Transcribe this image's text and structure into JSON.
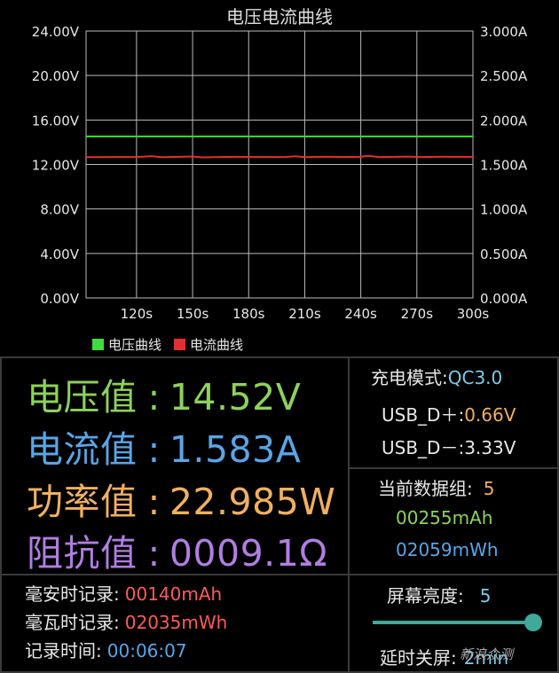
{
  "colors": {
    "voltage": "#3fdc3f",
    "current": "#e23030",
    "green_value": "#8ed15c",
    "blue_value": "#58a6e8",
    "orange_value": "#f0b060",
    "purple_value": "#b07ee0",
    "red_value": "#ff5a5a",
    "cyan_value": "#7ecbe8",
    "slider": "#3fa99a"
  },
  "chart_data": {
    "type": "line",
    "title": "电压电流曲线",
    "x_ticks": [
      "120s",
      "150s",
      "180s",
      "210s",
      "240s",
      "270s",
      "300s"
    ],
    "xlim": [
      93,
      300
    ],
    "y_left_ticks": [
      "0.00V",
      "4.00V",
      "8.00V",
      "12.00V",
      "16.00V",
      "20.00V",
      "24.00V"
    ],
    "y_right_ticks": [
      "0.000A",
      "0.500A",
      "1.000A",
      "1.500A",
      "2.000A",
      "2.500A",
      "3.000A"
    ],
    "ylim_left": [
      0,
      24
    ],
    "ylim_right": [
      0,
      3
    ],
    "grid": true,
    "legend_position": "bottom-left",
    "series": [
      {
        "name": "电压曲线",
        "axis": "left",
        "x": [
          93,
          300
        ],
        "values": [
          14.52,
          14.52
        ]
      },
      {
        "name": "电流曲线",
        "axis": "right",
        "x": [
          93,
          120,
          128,
          133,
          135,
          140,
          150,
          155,
          165,
          175,
          185,
          200,
          205,
          210,
          220,
          230,
          240,
          244,
          250,
          258,
          265,
          272,
          285,
          300
        ],
        "values": [
          1.583,
          1.584,
          1.594,
          1.583,
          1.582,
          1.585,
          1.59,
          1.58,
          1.584,
          1.586,
          1.584,
          1.585,
          1.592,
          1.583,
          1.588,
          1.584,
          1.586,
          1.598,
          1.583,
          1.586,
          1.589,
          1.584,
          1.587,
          1.586
        ]
      }
    ]
  },
  "readings": {
    "voltage": {
      "label": "电压值",
      "colon": ":",
      "value": "14.52V"
    },
    "current": {
      "label": "电流值",
      "colon": ":",
      "value": "1.583A"
    },
    "power": {
      "label": "功率值",
      "colon": ":",
      "value": "22.985W"
    },
    "impedance": {
      "label": "阻抗值",
      "colon": ":",
      "value": "0009.1Ω"
    }
  },
  "mode": {
    "label": "充电模式:",
    "value": "QC3.0",
    "dplus_label": "USB_D＋:",
    "dplus_value": "0.66V",
    "dminus_label": "USB_D－:",
    "dminus_value": "3.33V"
  },
  "group": {
    "label": "当前数据组:",
    "number": "5",
    "mah": "00255mAh",
    "mwh": "02059mWh"
  },
  "record": {
    "mah_label": "毫安时记录:",
    "mah_value": "00140mAh",
    "mwh_label": "毫瓦时记录:",
    "mwh_value": "02035mWh",
    "time_label": "记录时间:",
    "time_value": "00:06:07"
  },
  "brightness": {
    "label": "屏幕亮度:",
    "value": "5",
    "level_fraction": 1.0,
    "delay_label": "延时关屏:",
    "delay_value": "2min"
  },
  "watermark": "新浪众测"
}
